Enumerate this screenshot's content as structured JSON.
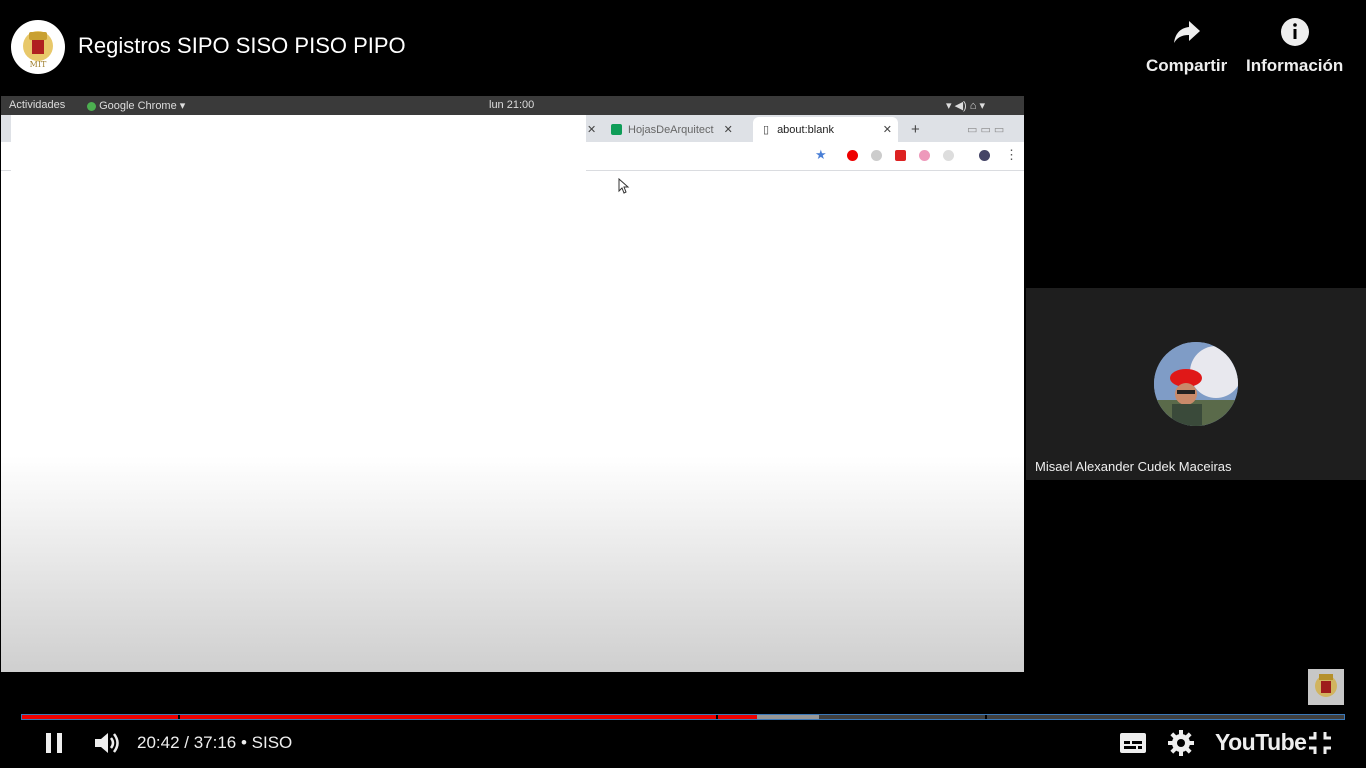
{
  "video": {
    "title": "Registros SIPO SISO PISO PIPO"
  },
  "top_actions": {
    "share_label": "Compartir",
    "info_label": "Información"
  },
  "shared_screen": {
    "gnome_bar": {
      "activities": "Actividades",
      "app": "Google Chrome",
      "clock": "lun 21:00"
    },
    "tabs": [
      {
        "label": "HojasDeArquitect"
      },
      {
        "label": "about:blank"
      }
    ]
  },
  "participant": {
    "name": "Misael Alexander Cudek Maceiras"
  },
  "player": {
    "time": "20:42 / 37:16 • SISO",
    "progress_fraction": 0.556,
    "buffered_fraction": 0.603,
    "brand": "YouTube"
  },
  "colors": {
    "progress": "#ee0000",
    "accent": "#3a78b8"
  },
  "icons": [
    "share-icon",
    "info-icon",
    "pause-icon",
    "volume-icon",
    "subtitles-icon",
    "settings-icon",
    "exit-fullscreen-icon"
  ]
}
